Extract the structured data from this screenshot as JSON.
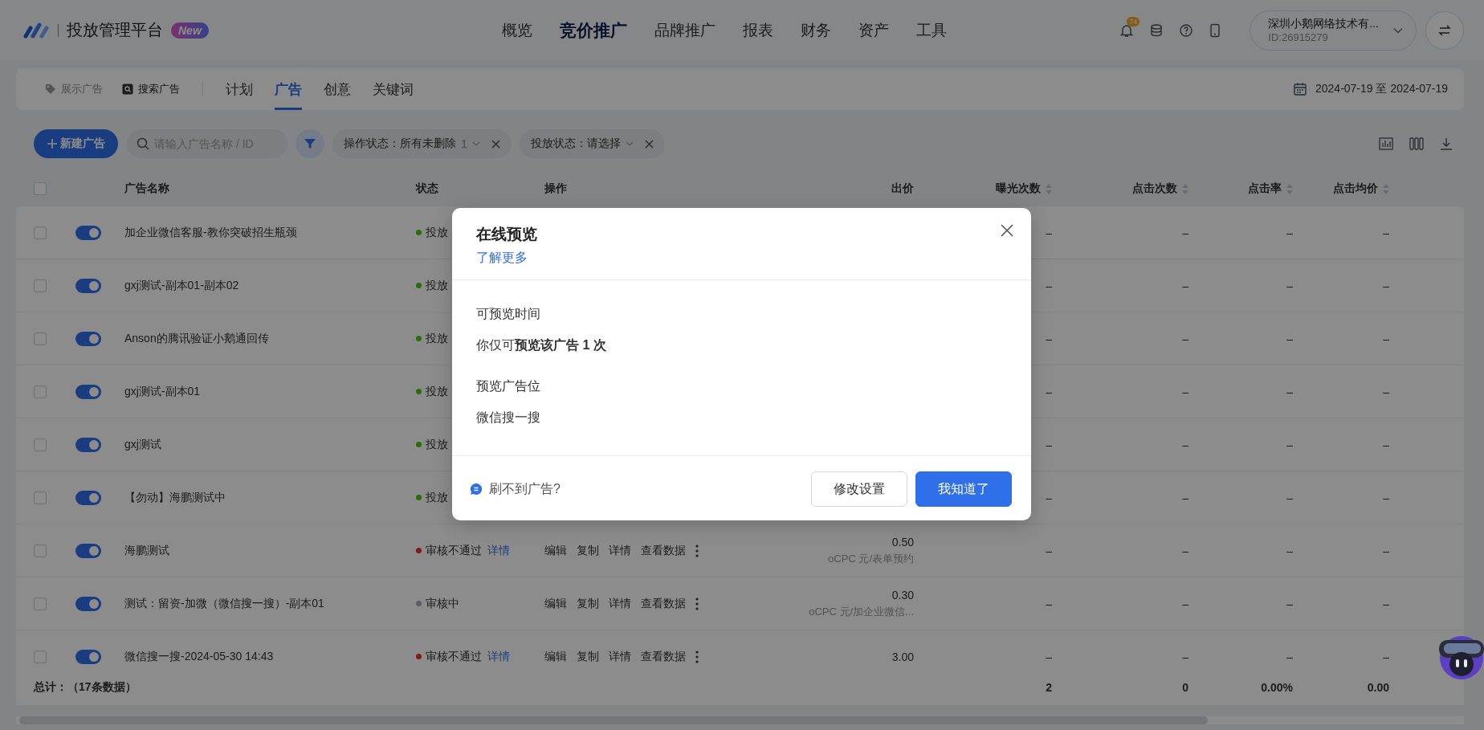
{
  "header": {
    "title": "投放管理平台",
    "badge": "New",
    "nav": [
      {
        "label": "概览",
        "selected": false
      },
      {
        "label": "竞价推广",
        "selected": true
      },
      {
        "label": "品牌推广",
        "selected": false
      },
      {
        "label": "报表",
        "selected": false
      },
      {
        "label": "财务",
        "selected": false
      },
      {
        "label": "资产",
        "selected": false
      },
      {
        "label": "工具",
        "selected": false
      }
    ],
    "notification_count": "74",
    "account": {
      "name": "深圳小鹅网络技术有...",
      "id": "ID:26915279"
    }
  },
  "subnav": {
    "ad_types": [
      {
        "label": "展示广告",
        "selected": false
      },
      {
        "label": "搜索广告",
        "selected": true
      }
    ],
    "tabs": [
      {
        "label": "计划",
        "selected": false
      },
      {
        "label": "广告",
        "selected": true
      },
      {
        "label": "创意",
        "selected": false
      },
      {
        "label": "关键词",
        "selected": false
      }
    ],
    "date_range": "2024-07-19 至 2024-07-19"
  },
  "toolbar": {
    "new_button": "新建广告",
    "search": {
      "placeholder": "请输入广告名称 / ID"
    },
    "filters": [
      {
        "label": "操作状态：所有未删除",
        "count": "1"
      },
      {
        "label": "投放状态：请选择"
      }
    ]
  },
  "table": {
    "select_all": {
      "checked": false
    },
    "columns": [
      {
        "label": "广告名称",
        "sortable": false
      },
      {
        "label": "状态",
        "sortable": false
      },
      {
        "label": "操作",
        "sortable": false
      },
      {
        "label": "出价",
        "sortable": false
      },
      {
        "label": "曝光次数",
        "sortable": true
      },
      {
        "label": "点击次数",
        "sortable": true
      },
      {
        "label": "点击率",
        "sortable": true
      },
      {
        "label": "点击均价",
        "sortable": true
      }
    ],
    "rows": [
      {
        "name": "加企业微信客服-教你突破招生瓶颈",
        "checked": false,
        "on": true,
        "status": {
          "text": "投放",
          "color": "#2d6c0e"
        },
        "metrics": [
          "–",
          "–",
          "–",
          "–"
        ]
      },
      {
        "name": "gxj测试-副本01-副本02",
        "checked": false,
        "on": true,
        "status": {
          "text": "投放",
          "color": "#2d6c0e"
        },
        "metrics": [
          "–",
          "–",
          "–",
          "–"
        ]
      },
      {
        "name": "Anson的腾讯验证小鹅通回传",
        "checked": false,
        "on": true,
        "status": {
          "text": "投放",
          "color": "#2d6c0e"
        },
        "metrics": [
          "–",
          "–",
          "–",
          "–"
        ]
      },
      {
        "name": "gxj测试-副本01",
        "checked": false,
        "on": true,
        "status": {
          "text": "投放",
          "color": "#2d6c0e"
        },
        "metrics": [
          "–",
          "–",
          "–",
          "–"
        ]
      },
      {
        "name": "gxj测试",
        "checked": false,
        "on": true,
        "status": {
          "text": "投放",
          "color": "#2d6c0e"
        },
        "metrics": [
          "–",
          "–",
          "–",
          "–"
        ]
      },
      {
        "name": "【勿动】海鹏测试中",
        "checked": false,
        "on": true,
        "status": {
          "text": "投放",
          "color": "#2d6c0e"
        },
        "metrics": [
          "–",
          "–",
          "–",
          "–"
        ]
      },
      {
        "name": "海鹏测试",
        "checked": false,
        "on": true,
        "status": {
          "text": "审核不通过",
          "color": "#7e1c18",
          "link": "详情"
        },
        "actions": [
          "编辑",
          "复制",
          "详情",
          "查看数据"
        ],
        "bid": "0.50",
        "bid_note": "oCPC 元/表单预约",
        "metrics": [
          "–",
          "–",
          "–",
          "–"
        ]
      },
      {
        "name": "测试：留资-加微（微信搜一搜）-副本01",
        "checked": false,
        "on": true,
        "status": {
          "text": "审核中",
          "color": "#5c5e62"
        },
        "actions": [
          "编辑",
          "复制",
          "详情",
          "查看数据"
        ],
        "bid": "0.30",
        "bid_note": "oCPC 元/加企业微信...",
        "metrics": [
          "–",
          "–",
          "–",
          "–"
        ]
      },
      {
        "name": "微信搜一搜-2024-05-30 14:43",
        "checked": false,
        "on": true,
        "status": {
          "text": "审核不通过",
          "color": "#7e1c18",
          "link": "详情"
        },
        "actions": [
          "编辑",
          "复制",
          "详情",
          "查看数据"
        ],
        "bid": "3.00",
        "metrics": [
          "–",
          "–",
          "–",
          "–"
        ]
      }
    ],
    "total": {
      "label": "总计：（17条数据）",
      "values": [
        "2",
        "0",
        "0.00%",
        "0.00"
      ]
    }
  },
  "dialog": {
    "title": "在线预览",
    "link": "了解更多",
    "sections": [
      {
        "label": "可预览时间",
        "value": "你仅可**预览该广告 1 次**"
      },
      {
        "label": "预览广告位",
        "value": "微信搜一搜"
      }
    ],
    "help": "刷不到广告?",
    "buttons": [
      {
        "label": "修改设置",
        "kind": "secondary"
      },
      {
        "label": "我知道了",
        "kind": "primary"
      }
    ]
  }
}
